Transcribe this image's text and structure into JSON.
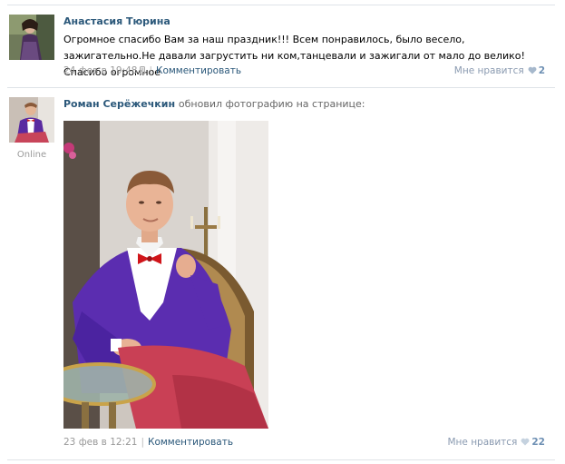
{
  "posts": [
    {
      "author": "Анастасия Тюрина",
      "text": "Огромное спасибо Вам за наш праздник!!! Всем понравилось, было весело, зажигательно.Не давали загрустить ни ком,танцевали и зажигали от мало до велико!Спасибо огромное",
      "date": "24 фев в 19:48",
      "date_icon": "phone-icon",
      "comment_label": "Комментировать",
      "like_label": "Мне нравится",
      "like_count": "2",
      "like_icon": "heart-icon"
    },
    {
      "author": "Роман Серёжечкин",
      "action": "обновил фотографию на странице:",
      "status": "Online",
      "date": "23 фев в 12:21",
      "comment_label": "Комментировать",
      "like_label": "Мне нравится",
      "like_count": "22",
      "like_icon": "heart-icon"
    }
  ],
  "colors": {
    "link": "#2b587a",
    "muted": "#999999",
    "like": "#8a9ab0",
    "divider": "#dfe3e8"
  }
}
